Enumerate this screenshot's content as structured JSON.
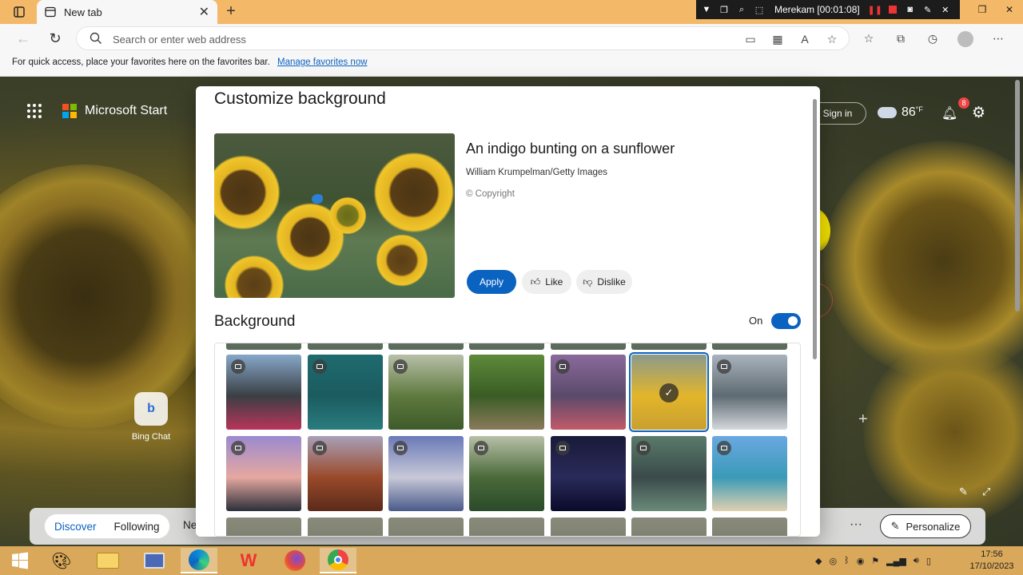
{
  "browser": {
    "tab_title": "New tab",
    "address_placeholder": "Search or enter web address",
    "favorites_message": "For quick access, place your favorites here on the favorites bar.",
    "favorites_link": "Manage favorites now"
  },
  "recorder": {
    "status": "Merekam [00:01:08]"
  },
  "newtab": {
    "brand": "Microsoft Start",
    "signin": "Sign in",
    "temperature": "86",
    "temp_unit": "°F",
    "notification_count": "8",
    "bing_chat": "Bing Chat"
  },
  "feed": {
    "tabs": [
      "Discover",
      "Following",
      "Ne"
    ],
    "more": "···",
    "personalize": "Personalize"
  },
  "dialog": {
    "title": "Customize background",
    "photo_title": "An indigo bunting on a sunflower",
    "photo_credit": "William Krumpelman/Getty Images",
    "photo_copyright": "© Copyright",
    "apply": "Apply",
    "like": "Like",
    "dislike": "Dislike",
    "background_label": "Background",
    "toggle_label": "On",
    "toggle_on": true
  },
  "gallery": {
    "row1": [
      {
        "name": "mount-fuji",
        "video": true,
        "colors": [
          "#87a8c9",
          "#3a3f44",
          "#b8345a"
        ]
      },
      {
        "name": "ocean-waves",
        "video": true,
        "colors": [
          "#1e6b6f",
          "#1b5b5f",
          "#2a7c7e"
        ]
      },
      {
        "name": "green-hills",
        "video": true,
        "colors": [
          "#b8bfa8",
          "#5f7a3f",
          "#3d5a2a"
        ]
      },
      {
        "name": "forest-path",
        "video": false,
        "colors": [
          "#5e8a3a",
          "#3a5c25",
          "#8a7a5a"
        ]
      },
      {
        "name": "city-harbor",
        "video": true,
        "colors": [
          "#8a6a9c",
          "#5a4a6a",
          "#c25a6a"
        ]
      },
      {
        "name": "sunflower-bunting",
        "video": false,
        "selected": true,
        "colors": [
          "#8b9a8c",
          "#e2b52a",
          "#c9a030"
        ]
      },
      {
        "name": "misty-mountains",
        "video": true,
        "colors": [
          "#a9b3bd",
          "#5e6a72",
          "#d4d8dc"
        ]
      }
    ],
    "row2": [
      {
        "name": "sunset-peak",
        "video": true,
        "colors": [
          "#9a8ad0",
          "#e6a8a0",
          "#2b2f3a"
        ]
      },
      {
        "name": "canyon-river",
        "video": true,
        "colors": [
          "#a8a0b8",
          "#9a4a2a",
          "#5a2a1a"
        ]
      },
      {
        "name": "cloud-village",
        "video": true,
        "colors": [
          "#6a7ab8",
          "#c8c8d8",
          "#4a5a8a"
        ]
      },
      {
        "name": "green-ridge",
        "video": true,
        "colors": [
          "#b8c0a8",
          "#4a6a3a",
          "#2a4a2a"
        ]
      },
      {
        "name": "starry-sky",
        "video": true,
        "colors": [
          "#1a1a3a",
          "#2a2a5a",
          "#0a0a2a"
        ]
      },
      {
        "name": "highway-aerial",
        "video": true,
        "colors": [
          "#5a7a6a",
          "#3a4a4a",
          "#6a8a7a"
        ]
      },
      {
        "name": "beach-shore",
        "video": true,
        "colors": [
          "#6aa8e0",
          "#3a9ab8",
          "#e0d0b0"
        ]
      }
    ]
  },
  "taskbar": {
    "time": "17:56",
    "date": "17/10/2023"
  },
  "colors": {
    "accent": "#0b63c1",
    "titlebar": "#f3b868",
    "taskbar": "#d9a85a"
  }
}
